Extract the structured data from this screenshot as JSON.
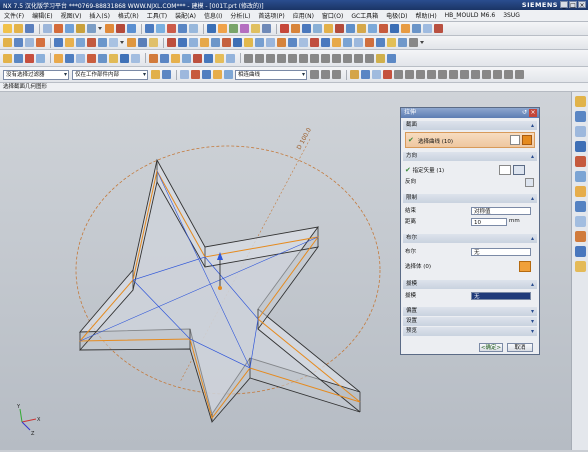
{
  "window": {
    "title": "NX 7.5 汉化版学习平台  ***0769-88831868  WWW.NJXL.COM***  - 建模 - [001T.prt (修改的)]",
    "brand": "SIEMENS",
    "min": "_",
    "max": "□",
    "close": "×"
  },
  "menu": [
    "文件(F)",
    "编辑(E)",
    "视图(V)",
    "插入(S)",
    "格式(R)",
    "工具(T)",
    "装配(A)",
    "信息(I)",
    "分析(L)",
    "首选项(P)",
    "应用(N)",
    "窗口(O)",
    "GC工具箱",
    "电极(D)",
    "帮助(H)",
    "HB_MOULD M6.6",
    "3SUG"
  ],
  "toolbar": {
    "filter_select": "没有选择过滤器",
    "scope_select": "仅在工作部件内部",
    "snap_select": "相连曲线"
  },
  "cue": "选择截面几何图形",
  "dialog": {
    "title": "拉伸",
    "reset": "↺",
    "close": "×",
    "section_header": "截面",
    "select_curve": "选择曲线 (10)",
    "direction_header": "方向",
    "specify_vector": "指定矢量 (1)",
    "reverse": "反向",
    "limits_header": "限制",
    "end_label": "结束",
    "end_value": "对称值",
    "distance_label": "距离",
    "distance_value": "10",
    "distance_unit": "mm",
    "boolean_header": "布尔",
    "boolean_label": "布尔",
    "boolean_value": "无",
    "select_body": "选择体 (0)",
    "draft_header": "拔模",
    "draft_label": "拔模",
    "draft_value": "无",
    "offset_header": "偏置",
    "settings_header": "设置",
    "preview_header": "预览",
    "ok": "<确定>",
    "cancel": "取消"
  },
  "viewport": {
    "dimension": "D 100.0",
    "triad_x": "X",
    "triad_y": "Y",
    "triad_z": "Z"
  },
  "colors": {
    "accent": "#2a4d8f",
    "selection_orange": "#e58a1e",
    "preview_blue": "#2f56d9",
    "confirm_green": "#3f9a3a"
  }
}
